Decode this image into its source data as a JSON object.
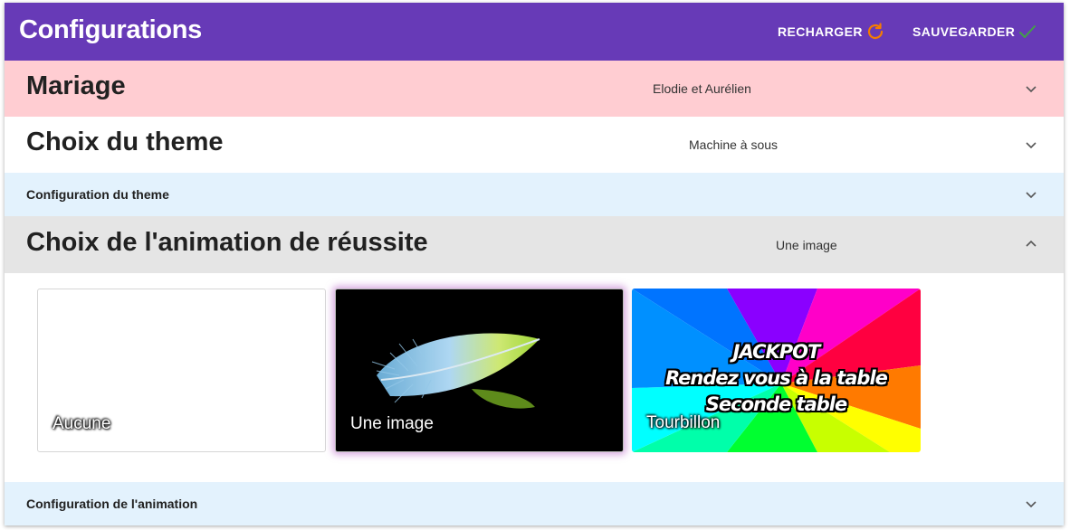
{
  "app": {
    "title": "Configurations",
    "reload_label": "RECHARGER",
    "save_label": "SAUVEGARDER",
    "primary_color": "#673ab7",
    "reload_icon_color": "#f57c00",
    "save_icon_color": "#43a047"
  },
  "sections": {
    "mariage": {
      "title": "Mariage",
      "value": "Elodie et Aurélien",
      "expanded": false,
      "bg": "#ffcdd2"
    },
    "theme": {
      "title": "Choix du theme",
      "value": "Machine à sous",
      "expanded": false
    },
    "theme_config": {
      "title": "Configuration du theme",
      "expanded": false
    },
    "animation": {
      "title": "Choix de l'animation de réussite",
      "value": "Une image",
      "expanded": true
    },
    "animation_config": {
      "title": "Configuration de l'animation",
      "expanded": false
    }
  },
  "animation_options": [
    {
      "label": "Aucune",
      "selected": false
    },
    {
      "label": "Une image",
      "selected": true
    },
    {
      "label": "Tourbillon",
      "selected": false,
      "banner_lines": [
        "JACKPOT",
        "Rendez vous à la table",
        "Seconde table"
      ]
    }
  ],
  "icons": {
    "reload": "reload-icon",
    "save": "check-icon",
    "expand": "chevron-down-icon",
    "collapse": "chevron-up-icon"
  }
}
